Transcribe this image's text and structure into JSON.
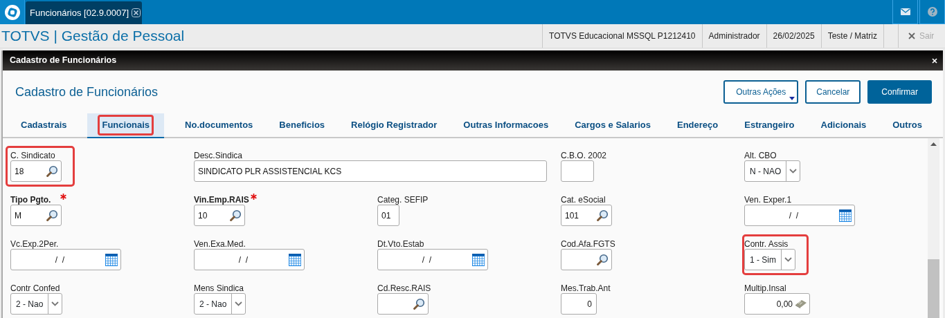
{
  "app_tab": {
    "title": "Funcionários [02.9.0007]",
    "selected": true
  },
  "header": {
    "title": "TOTVS | Gestão de Pessoal",
    "info": [
      "TOTVS Educacional MSSQL P1212410",
      "Administrador",
      "26/02/2025",
      "Teste / Matriz"
    ],
    "exit": {
      "label": "Sair",
      "disabled": true
    }
  },
  "dialog": {
    "title": "Cadastro de Funcionários",
    "form_title": "Cadastro de Funcionários",
    "buttons": [
      {
        "label": "Outras Ações",
        "kind": "menu"
      },
      {
        "label": "Cancelar",
        "kind": "secondary"
      },
      {
        "label": "Confirmar",
        "kind": "primary"
      }
    ],
    "tabs": [
      {
        "label": "Cadastrais",
        "selected": false,
        "highlighted": false
      },
      {
        "label": "Funcionais",
        "selected": true,
        "highlighted": true
      },
      {
        "label": "No.documentos",
        "selected": false,
        "highlighted": false
      },
      {
        "label": "Beneficios",
        "selected": false,
        "highlighted": false
      },
      {
        "label": "Relógio Registrador",
        "selected": false,
        "highlighted": false
      },
      {
        "label": "Outras Informacoes",
        "selected": false,
        "highlighted": false
      },
      {
        "label": "Cargos e Salarios",
        "selected": false,
        "highlighted": false
      },
      {
        "label": "Endereço",
        "selected": false,
        "highlighted": false
      },
      {
        "label": "Estrangeiro",
        "selected": false,
        "highlighted": false
      },
      {
        "label": "Adicionais",
        "selected": false,
        "highlighted": false
      },
      {
        "label": "Outros",
        "selected": false,
        "highlighted": false
      }
    ],
    "rows": [
      [
        {
          "label": "C. Sindicato",
          "kind": "lookup",
          "value": "18",
          "required": false,
          "highlighted": true
        },
        {
          "label": "Desc.Sindica",
          "kind": "text",
          "value": "SINDICATO PLR ASSISTENCIAL KCS",
          "required": false,
          "highlighted": false
        },
        "",
        {
          "label": "C.B.O. 2002",
          "kind": "text",
          "required": false,
          "highlighted": false
        },
        {
          "label": "Alt. CBO",
          "kind": "select",
          "value": "N - NAO",
          "required": false,
          "highlighted": false
        }
      ],
      [
        {
          "label": "Tipo Pgto.",
          "kind": "lookup",
          "value": "M",
          "required": true,
          "highlighted": false
        },
        {
          "label": "Vin.Emp.RAIS",
          "kind": "lookup",
          "value": "10",
          "required": true,
          "highlighted": false
        },
        {
          "label": "Categ. SEFIP",
          "kind": "text",
          "value": "01",
          "required": false,
          "highlighted": false
        },
        {
          "label": "Cat. eSocial",
          "kind": "lookup",
          "value": "101",
          "required": false,
          "highlighted": false
        },
        {
          "label": "Ven. Exper.1",
          "kind": "date",
          "value": "/  /",
          "required": false,
          "highlighted": false
        }
      ],
      [
        {
          "label": "Vc.Exp.2Per.",
          "kind": "date",
          "value": "/  /",
          "required": false,
          "highlighted": false
        },
        {
          "label": "Ven.Exa.Med.",
          "kind": "date",
          "value": "/  /",
          "required": false,
          "highlighted": false
        },
        {
          "label": "Dt.Vto.Estab",
          "kind": "date",
          "value": "/  /",
          "required": false,
          "highlighted": false
        },
        {
          "label": "Cod.Afa.FGTS",
          "kind": "lookup",
          "required": false,
          "highlighted": false
        },
        {
          "label": "Contr. Assis",
          "kind": "select",
          "value": "1 - Sim",
          "required": false,
          "highlighted": true
        }
      ],
      [
        {
          "label": "Contr Confed",
          "kind": "select",
          "value": "2 - Nao",
          "required": false,
          "highlighted": false
        },
        {
          "label": "Mens Sindica",
          "kind": "select",
          "value": "2 - Nao",
          "required": false,
          "highlighted": false
        },
        {
          "label": "Cd.Resc.RAIS",
          "kind": "lookup",
          "required": false,
          "highlighted": false
        },
        {
          "label": "Mes.Trab.Ant",
          "kind": "number",
          "value": "0",
          "required": false,
          "highlighted": false
        },
        {
          "label": "Multip.Insal",
          "kind": "calc",
          "value": "0,00",
          "required": false,
          "highlighted": false
        }
      ]
    ]
  }
}
